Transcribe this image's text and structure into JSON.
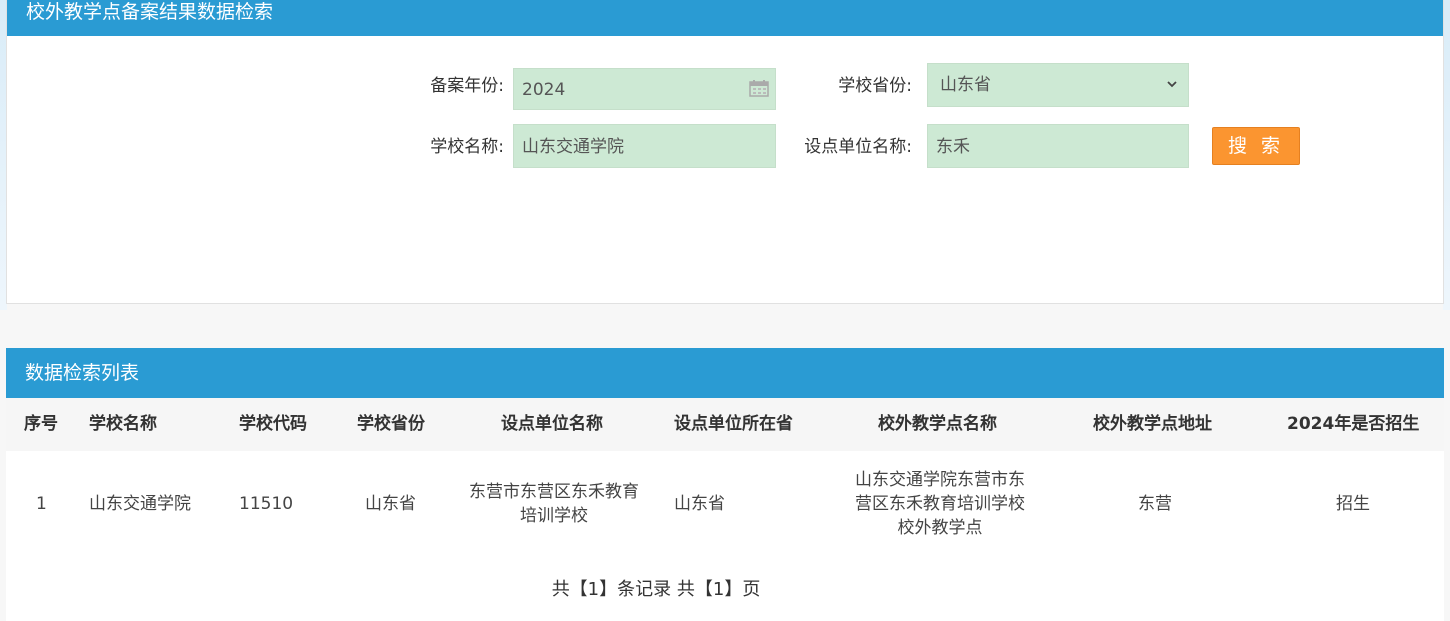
{
  "search": {
    "title": "校外教学点备案结果数据检索",
    "year_label": "备案年份:",
    "year_value": "2024",
    "province_label": "学校省份:",
    "province_value": "山东省",
    "school_label": "学校名称:",
    "school_value": "山东交通学院",
    "unit_label": "设点单位名称:",
    "unit_value": "东禾",
    "search_button": "搜 索"
  },
  "list": {
    "title": "数据检索列表",
    "columns": [
      "序号",
      "学校名称",
      "学校代码",
      "学校省份",
      "设点单位名称",
      "设点单位所在省",
      "校外教学点名称",
      "校外教学点地址",
      "2024年是否招生"
    ],
    "rows": [
      {
        "index": "1",
        "school": "山东交通学院",
        "code": "11510",
        "province": "山东省",
        "unit_line1": "东营市东营区东禾教育",
        "unit_line2": "培训学校",
        "unit_province": "山东省",
        "point_line1": "山东交通学院东营市东",
        "point_line2": "营区东禾教育培训学校",
        "point_line3": "校外教学点",
        "address": "东营",
        "enroll": "招生"
      }
    ],
    "pager": "共【1】条记录 共【1】页"
  },
  "colors": {
    "header_blue": "#2a9bd3",
    "field_green": "#cde9d4",
    "button_orange": "#fb9530"
  },
  "icons": [
    "calendar-icon",
    "chevron-down-icon"
  ]
}
